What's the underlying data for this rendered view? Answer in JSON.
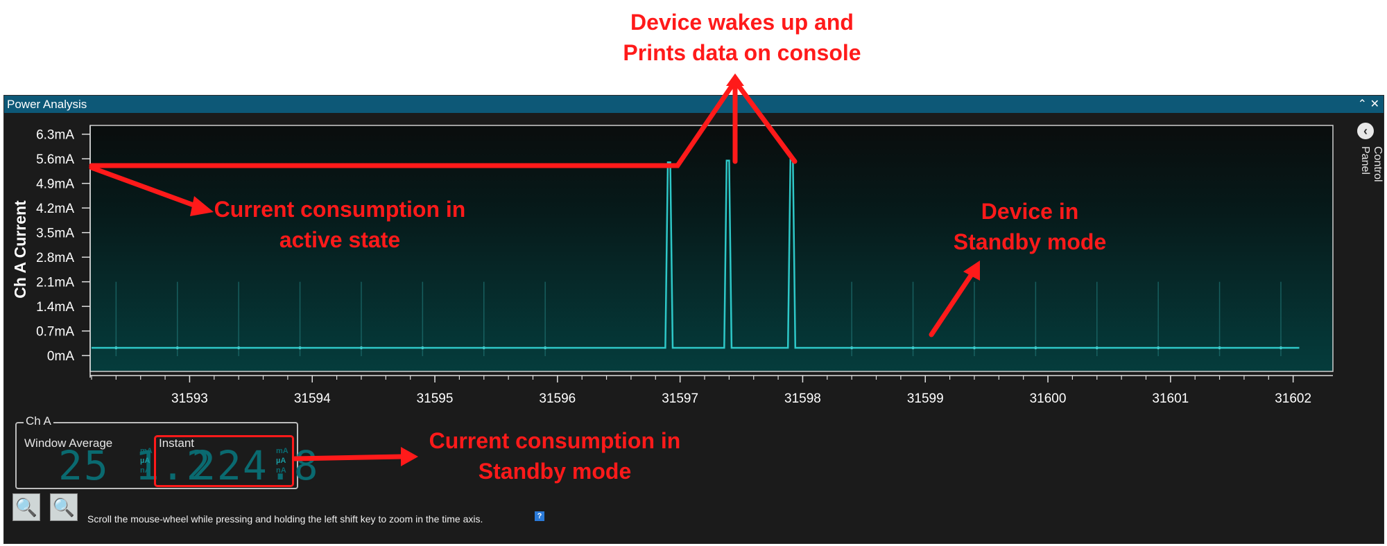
{
  "window": {
    "title": "Power Analysis",
    "collapse_glyph": "⌃",
    "close_glyph": "✕"
  },
  "control_panel": {
    "label": "Control Panel",
    "icon": "chevron-left-circle-icon",
    "glyph": "‹"
  },
  "chart_data": {
    "type": "line",
    "ylabel": "Ch A Current",
    "y_ticks": [
      "6.3mA",
      "5.6mA",
      "4.9mA",
      "4.2mA",
      "3.5mA",
      "2.8mA",
      "2.1mA",
      "1.4mA",
      "0.7mA",
      "0mA"
    ],
    "y_tick_values": [
      6.3,
      5.6,
      4.9,
      4.2,
      3.5,
      2.8,
      2.1,
      1.4,
      0.7,
      0
    ],
    "x_ticks": [
      "31593",
      "31594",
      "31595",
      "31596",
      "31597",
      "31598",
      "31599",
      "31600",
      "31601",
      "31602"
    ],
    "x_tick_values": [
      31593,
      31594,
      31595,
      31596,
      31597,
      31598,
      31599,
      31600,
      31601,
      31602
    ],
    "xlim": [
      31592.2,
      31602.2
    ],
    "ylim": [
      -0.45,
      6.55
    ],
    "baseline_mA": 0.22,
    "series": [
      {
        "x": [
          31592.2,
          31596.88,
          31596.9,
          31596.92,
          31596.94,
          31597.36,
          31597.38,
          31597.4,
          31597.42,
          31597.88,
          31597.9,
          31597.92,
          31597.94,
          31602.05
        ],
        "values": [
          0.22,
          0.22,
          5.5,
          5.5,
          0.22,
          0.22,
          5.55,
          5.55,
          0.22,
          0.22,
          5.6,
          5.6,
          0.22,
          0.22
        ]
      }
    ],
    "minor_spikes_x": [
      31592.4,
      31592.9,
      31593.4,
      31593.9,
      31594.4,
      31594.9,
      31595.4,
      31595.9,
      31598.4,
      31598.9,
      31599.4,
      31599.9,
      31600.4,
      31600.9,
      31601.4,
      31601.9
    ],
    "minor_spike_peak_mA": 2.1,
    "grid": false,
    "colors": {
      "line": "#2ec8c8",
      "plot_bg_top": "#0a0d0d",
      "plot_bg_bottom": "#063a3a"
    }
  },
  "channel": {
    "name": "Ch A",
    "window_average": {
      "label": "Window Average",
      "value": "25 1.2",
      "unit_top": "mA",
      "unit_mid": "µA",
      "unit_bot": "nA"
    },
    "instant": {
      "label": "Instant",
      "value": "224.8",
      "unit_top": "mA",
      "unit_mid": "µA",
      "unit_bot": "nA"
    }
  },
  "zoom": {
    "out_glyph": "🔍",
    "in_glyph": "🔍"
  },
  "hint": "Scroll the mouse-wheel while pressing and holding the left shift key to zoom in the time axis.",
  "help_glyph": "?",
  "annotations": {
    "wake": [
      "Device wakes up and",
      "Prints data on console"
    ],
    "active": [
      "Current consumption in",
      "active state"
    ],
    "standby_device": [
      "Device in",
      "Standby mode"
    ],
    "standby_current": [
      "Current consumption in",
      "Standby mode"
    ]
  },
  "annotation_color": "#ff1a1a"
}
